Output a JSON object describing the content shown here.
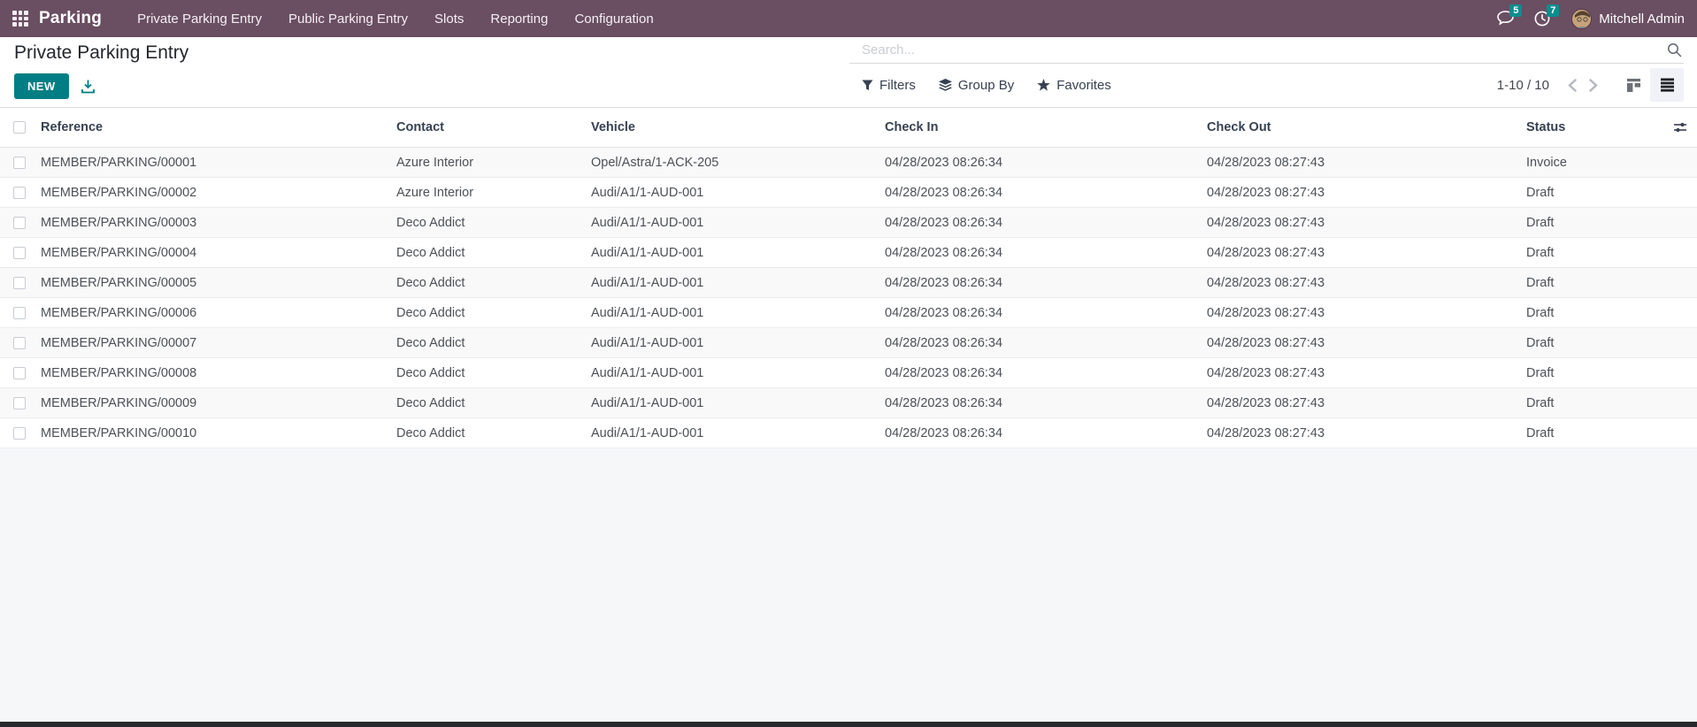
{
  "navbar": {
    "app_name": "Parking",
    "menu_items": [
      "Private Parking Entry",
      "Public Parking Entry",
      "Slots",
      "Reporting",
      "Configuration"
    ],
    "messages_count": "5",
    "activities_count": "7",
    "user_name": "Mitchell Admin"
  },
  "header": {
    "title": "Private Parking Entry",
    "new_button": "NEW",
    "search_placeholder": "Search..."
  },
  "controls": {
    "filters": "Filters",
    "group_by": "Group By",
    "favorites": "Favorites",
    "pager": "1-10 / 10"
  },
  "icons": {
    "apps": "apps-grid-icon",
    "messages": "chat-bubble-icon",
    "activities": "clock-icon",
    "export": "download-icon",
    "filters": "funnel-icon",
    "group_by": "layers-icon",
    "favorites": "star-icon",
    "search": "magnifier-icon",
    "pager_prev": "chevron-left-icon",
    "pager_next": "chevron-right-icon",
    "kanban": "kanban-view-icon",
    "list": "list-view-icon",
    "optional_columns": "sliders-icon"
  },
  "colors": {
    "navbar_bg": "#6a4e62",
    "badge": "#0e8c8f",
    "primary_button": "#017e84",
    "row_stripe": "#f9f9f9",
    "below_table_bg": "#f6f7f9"
  },
  "table": {
    "columns": [
      "Reference",
      "Contact",
      "Vehicle",
      "Check In",
      "Check Out",
      "Status"
    ],
    "rows": [
      {
        "reference": "MEMBER/PARKING/00001",
        "contact": "Azure Interior",
        "vehicle": "Opel/Astra/1-ACK-205",
        "check_in": "04/28/2023 08:26:34",
        "check_out": "04/28/2023 08:27:43",
        "status": "Invoice"
      },
      {
        "reference": "MEMBER/PARKING/00002",
        "contact": "Azure Interior",
        "vehicle": "Audi/A1/1-AUD-001",
        "check_in": "04/28/2023 08:26:34",
        "check_out": "04/28/2023 08:27:43",
        "status": "Draft"
      },
      {
        "reference": "MEMBER/PARKING/00003",
        "contact": "Deco Addict",
        "vehicle": "Audi/A1/1-AUD-001",
        "check_in": "04/28/2023 08:26:34",
        "check_out": "04/28/2023 08:27:43",
        "status": "Draft"
      },
      {
        "reference": "MEMBER/PARKING/00004",
        "contact": "Deco Addict",
        "vehicle": "Audi/A1/1-AUD-001",
        "check_in": "04/28/2023 08:26:34",
        "check_out": "04/28/2023 08:27:43",
        "status": "Draft"
      },
      {
        "reference": "MEMBER/PARKING/00005",
        "contact": "Deco Addict",
        "vehicle": "Audi/A1/1-AUD-001",
        "check_in": "04/28/2023 08:26:34",
        "check_out": "04/28/2023 08:27:43",
        "status": "Draft"
      },
      {
        "reference": "MEMBER/PARKING/00006",
        "contact": "Deco Addict",
        "vehicle": "Audi/A1/1-AUD-001",
        "check_in": "04/28/2023 08:26:34",
        "check_out": "04/28/2023 08:27:43",
        "status": "Draft"
      },
      {
        "reference": "MEMBER/PARKING/00007",
        "contact": "Deco Addict",
        "vehicle": "Audi/A1/1-AUD-001",
        "check_in": "04/28/2023 08:26:34",
        "check_out": "04/28/2023 08:27:43",
        "status": "Draft"
      },
      {
        "reference": "MEMBER/PARKING/00008",
        "contact": "Deco Addict",
        "vehicle": "Audi/A1/1-AUD-001",
        "check_in": "04/28/2023 08:26:34",
        "check_out": "04/28/2023 08:27:43",
        "status": "Draft"
      },
      {
        "reference": "MEMBER/PARKING/00009",
        "contact": "Deco Addict",
        "vehicle": "Audi/A1/1-AUD-001",
        "check_in": "04/28/2023 08:26:34",
        "check_out": "04/28/2023 08:27:43",
        "status": "Draft"
      },
      {
        "reference": "MEMBER/PARKING/00010",
        "contact": "Deco Addict",
        "vehicle": "Audi/A1/1-AUD-001",
        "check_in": "04/28/2023 08:26:34",
        "check_out": "04/28/2023 08:27:43",
        "status": "Draft"
      }
    ]
  }
}
